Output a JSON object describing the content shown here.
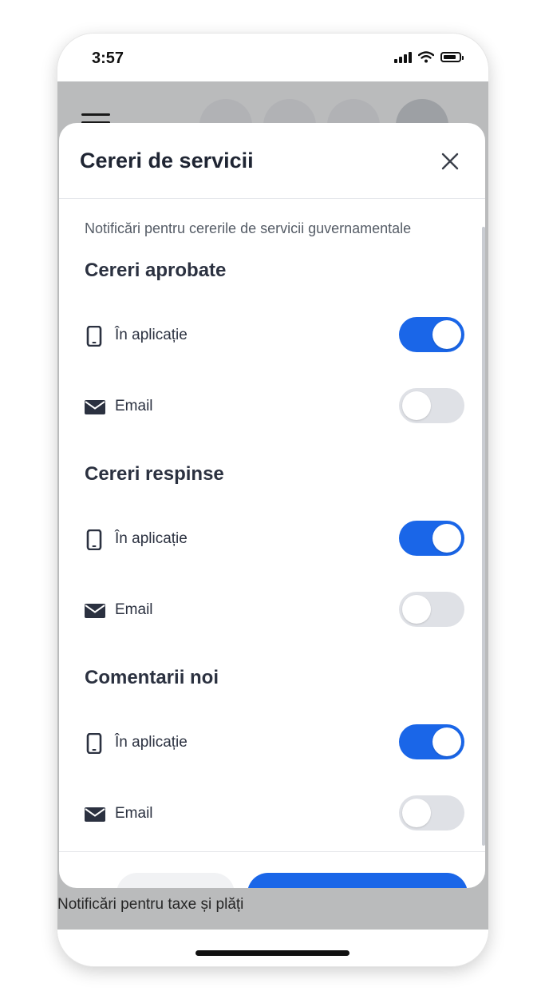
{
  "status_bar": {
    "time": "3:57"
  },
  "background": {
    "section_note": "Notificări pentru taxe și plăți"
  },
  "modal": {
    "title": "Cereri de servicii",
    "subtitle": "Notificări pentru cererile de servicii guvernamentale",
    "sections": [
      {
        "title": "Cereri aprobate",
        "rows": [
          {
            "label": "În aplicație",
            "icon": "phone-icon",
            "enabled": true
          },
          {
            "label": "Email",
            "icon": "envelope-icon",
            "enabled": false
          }
        ]
      },
      {
        "title": "Cereri respinse",
        "rows": [
          {
            "label": "În aplicație",
            "icon": "phone-icon",
            "enabled": true
          },
          {
            "label": "Email",
            "icon": "envelope-icon",
            "enabled": false
          }
        ]
      },
      {
        "title": "Comentarii noi",
        "rows": [
          {
            "label": "În aplicație",
            "icon": "phone-icon",
            "enabled": true
          },
          {
            "label": "Email",
            "icon": "envelope-icon",
            "enabled": false
          }
        ]
      }
    ]
  },
  "colors": {
    "accent": "#1a66e8",
    "toggle_off": "#dfe1e6",
    "text": "#2b3140"
  }
}
